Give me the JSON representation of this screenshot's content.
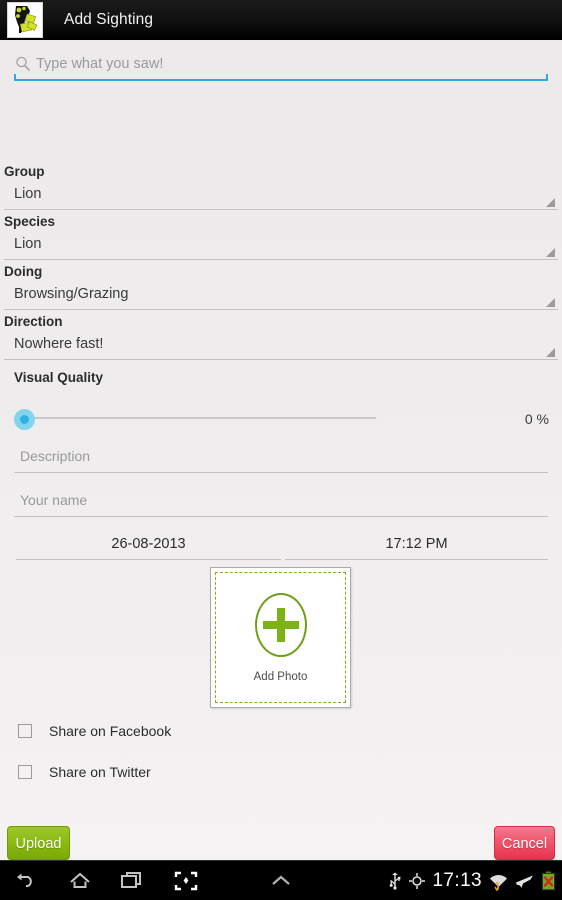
{
  "actionbar": {
    "back_icon": "back-chevron-icon",
    "app_icon": "africa-map-app-icon",
    "title": "Add Sighting"
  },
  "search": {
    "icon": "search-icon",
    "placeholder": "Type what you saw!",
    "value": ""
  },
  "form": {
    "fields": [
      {
        "label": "Group",
        "value": "Lion"
      },
      {
        "label": "Species",
        "value": "Lion"
      },
      {
        "label": "Doing",
        "value": "Browsing/Grazing"
      },
      {
        "label": "Direction",
        "value": "Nowhere fast!"
      }
    ],
    "visual_quality": {
      "label": "Visual Quality",
      "value": 0,
      "value_text": "0 %",
      "min": 0,
      "max": 100
    },
    "description": {
      "placeholder": "Description",
      "value": ""
    },
    "your_name": {
      "placeholder": "Your name",
      "value": ""
    },
    "date": {
      "value": "26-08-2013"
    },
    "time": {
      "value": "17:12 PM"
    },
    "photo": {
      "label": "Add Photo",
      "icon": "plus-oval-icon"
    },
    "checkboxes": [
      {
        "label": "Share on Facebook",
        "checked": false
      },
      {
        "label": "Share on Twitter",
        "checked": false
      }
    ]
  },
  "buttons": {
    "upload": "Upload",
    "cancel": "Cancel"
  },
  "navbar": {
    "back": "back-icon",
    "home": "home-icon",
    "recents": "recents-icon",
    "screenshot": "screenshot-icon",
    "expand": "chevron-up-icon",
    "usb": "usb-icon",
    "gps": "gps-icon",
    "clock": "17:13",
    "wifi": "wifi-icon",
    "airplane": "airplane-mode-icon",
    "battery": "battery-error-icon"
  },
  "colors": {
    "accent_blue": "#33a8dd",
    "upload_green": "#8dbc13",
    "cancel_red": "#ef5469",
    "photo_green": "#7cb118"
  }
}
